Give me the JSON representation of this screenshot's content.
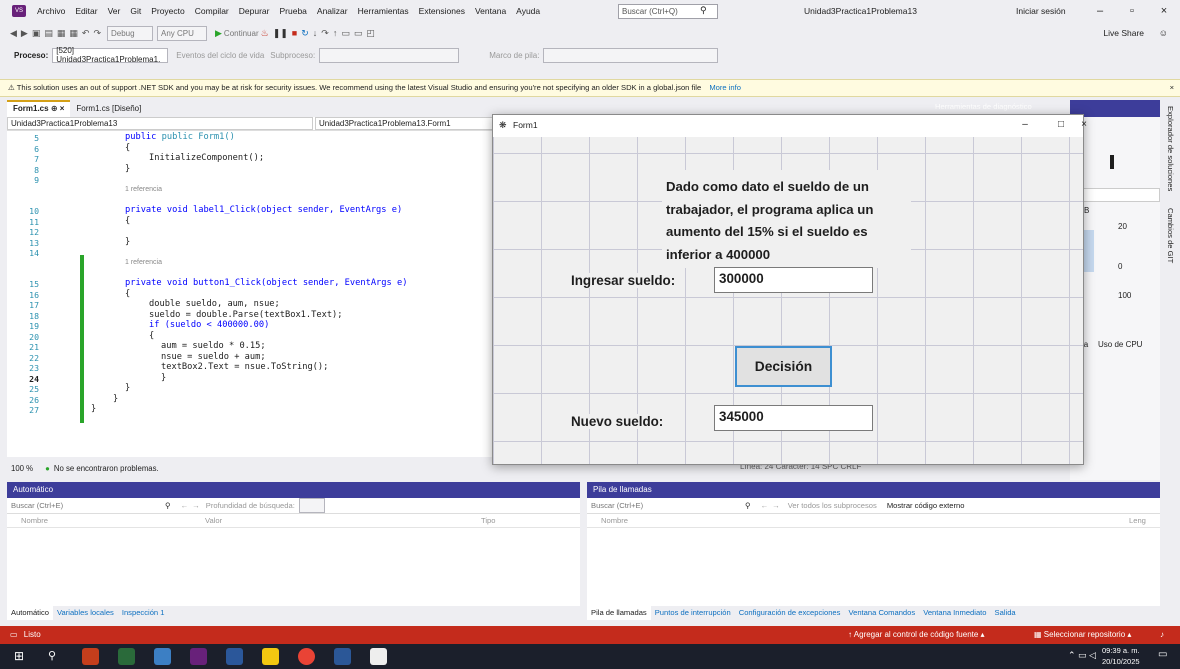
{
  "menu": {
    "logo": "VS",
    "items": [
      "Archivo",
      "Editar",
      "Ver",
      "Git",
      "Proyecto",
      "Compilar",
      "Depurar",
      "Prueba",
      "Analizar",
      "Herramientas",
      "Extensiones",
      "Ventana",
      "Ayuda"
    ],
    "search_placeholder": "Buscar (Ctrl+Q)",
    "solution_name": "Unidad3Practica1Problema13",
    "sign_in": "Iniciar sesión",
    "live_share": "Live Share"
  },
  "toolbar": {
    "config": "Debug",
    "platform": "Any CPU",
    "continue": "Continuar",
    "process_label": "Proceso:",
    "process_value": "[520] Unidad3Practica1Problema1.",
    "lifecycle": "Eventos del ciclo de vida",
    "thread": "Subproceso:",
    "stack_frame": "Marco de pila:"
  },
  "warning": {
    "text": "This solution uses an out of support .NET SDK and you may be at risk for security issues. We recommend using the latest Visual Studio and ensuring you're not specifying an older SDK in a global.json file",
    "link": "More info"
  },
  "editor": {
    "tabs": [
      "Form1.cs",
      "Form1.cs [Diseño]"
    ],
    "nav_project": "Unidad3Practica1Problema13",
    "nav_class": "Unidad3Practica1Problema13.Form1",
    "zoom": "100 %",
    "problems": "No se encontraron problemas.",
    "position": "Línea: 24   Carácter: 14   SPC   CRLF",
    "line_numbers": [
      "5",
      "6",
      "7",
      "8",
      "9",
      "10",
      "11",
      "12",
      "13",
      "14",
      "15",
      "16",
      "17",
      "18",
      "19",
      "20",
      "21",
      "22",
      "23",
      "24",
      "25",
      "26",
      "27"
    ],
    "ref_label": "1 referencia",
    "code": {
      "l5": "public Form1()",
      "l6": "{",
      "l7": "InitializeComponent();",
      "l8": "}",
      "l10": "private void label1_Click(object sender, EventArgs e)",
      "l11": "{",
      "l13": "}",
      "l15": "private void button1_Click(object sender, EventArgs e)",
      "l16": "{",
      "l17": "double sueldo, aum, nsue;",
      "l18": "sueldo = double.Parse(textBox1.Text);",
      "l19": "if (sueldo < 400000.00)",
      "l20": "{",
      "l21": "aum = sueldo * 0.15;",
      "l22": "nsue = sueldo + aum;",
      "l23": "textBox2.Text = nsue.ToString();",
      "l24": "}",
      "l25": "}",
      "l26": "}",
      "l27": "}"
    }
  },
  "diag": {
    "title": "Herramientas de diagnóstico",
    "v20": "20",
    "v0": "0",
    "v100": "100",
    "cpu": "Uso de CPU",
    "ia": "ia",
    "b": "B"
  },
  "sidebar": [
    "Explorador de soluciones",
    "Cambios de GIT"
  ],
  "form1": {
    "title": "Form1",
    "description": "Dado como dato el sueldo de un trabajador, el programa aplica un aumento del 15% si el sueldo es inferior a 400000",
    "input_label": "Ingresar sueldo:",
    "input_value": "300000",
    "button": "Decisión",
    "output_label": "Nuevo sueldo:",
    "output_value": "345000"
  },
  "autos": {
    "title": "Automático",
    "search": "Buscar (Ctrl+E)",
    "depth": "Profundidad de búsqueda:",
    "cols": [
      "Nombre",
      "Valor",
      "Tipo"
    ],
    "tabs": [
      "Automático",
      "Variables locales",
      "Inspección 1"
    ]
  },
  "callstack": {
    "title": "Pila de llamadas",
    "search": "Buscar (Ctrl+E)",
    "all_threads": "Ver todos los subprocesos",
    "external": "Mostrar código externo",
    "cols": [
      "Nombre",
      "Leng"
    ],
    "tabs": [
      "Pila de llamadas",
      "Puntos de interrupción",
      "Configuración de excepciones",
      "Ventana Comandos",
      "Ventana Inmediato",
      "Salida"
    ]
  },
  "status": {
    "ready": "Listo",
    "source_control": "Agregar al control de código fuente",
    "repo": "Seleccionar repositorio"
  },
  "taskbar": {
    "time": "09:39 a. m.",
    "date": "20/10/2025"
  },
  "colors": {
    "status_bar": "#c42b1c",
    "accent": "#3d8fd1",
    "panel_header": "#3d3d9a"
  }
}
